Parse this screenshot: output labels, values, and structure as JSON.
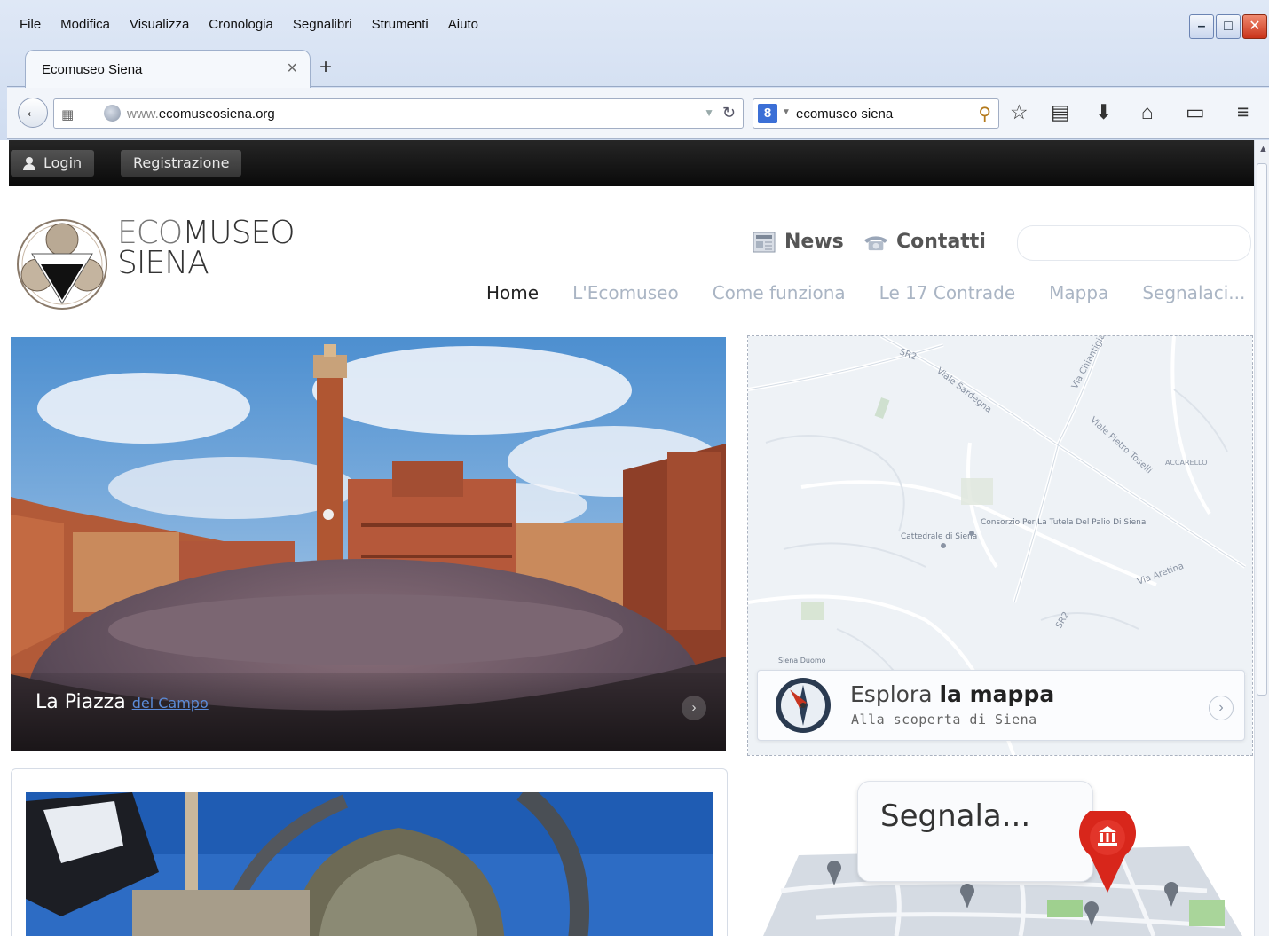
{
  "browser": {
    "menu": [
      "File",
      "Modifica",
      "Visualizza",
      "Cronologia",
      "Segnalibri",
      "Strumenti",
      "Aiuto"
    ],
    "tab_title": "Ecomuseo Siena",
    "url_prefix": "www.",
    "url_domain": "ecomuseosiena.org",
    "search_query": "ecomuseo siena",
    "search_engine_letter": "8",
    "icons": [
      "back-icon",
      "reload-icon",
      "star-icon",
      "clipboard-icon",
      "download-icon",
      "home-icon",
      "window-icon",
      "menu-icon"
    ]
  },
  "site": {
    "topbar": {
      "login": "Login",
      "register": "Registrazione"
    },
    "brand_line1_a": "ECO",
    "brand_line1_b": "MUSEO",
    "brand_line2": "SIENA",
    "util": {
      "news": "News",
      "contatti": "Contatti"
    },
    "nav": [
      "Home",
      "L'Ecomuseo",
      "Come funziona",
      "Le 17 Contrade",
      "Mappa",
      "Segnalaci..."
    ],
    "hero": {
      "caption_main": "La Piazza",
      "caption_link": "del Campo"
    },
    "map_card": {
      "title_light": "Esplora",
      "title_bold": "la mappa",
      "subtitle": "Alla scoperta di Siena"
    },
    "map_labels": [
      "SR2",
      "Viale Sardegna",
      "Via Chiantigiana",
      "Viale Pietro Toselli",
      "ACCARELLO",
      "Consorzio Per La Tutela Del Palio Di Siena",
      "Cattedrale di Siena",
      "Via Aretina",
      "SR2",
      "Siena Duomo"
    ],
    "segnala": "Segnala..."
  },
  "colors": {
    "topbar": "#111111",
    "nav_active": "#222222",
    "nav_inactive": "#aab5c4",
    "pin": "#d8261b"
  }
}
